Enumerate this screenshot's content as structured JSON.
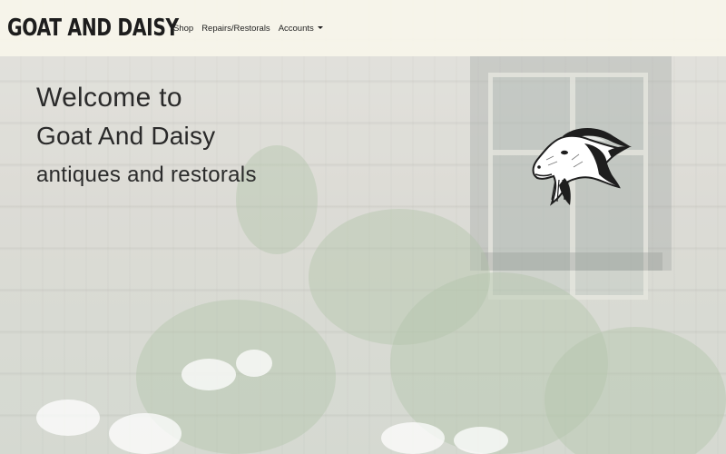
{
  "navbar": {
    "brand": "GOAT AND DAISY",
    "links": [
      {
        "label": "Shop"
      },
      {
        "label": "Repairs/Restorals"
      },
      {
        "label": "Accounts",
        "dropdown": true
      }
    ]
  },
  "hero": {
    "line1": "Welcome to",
    "line2": "Goat And Daisy",
    "line3": "antiques and restorals"
  },
  "icons": {
    "goat": "goat-head-icon",
    "caret": "caret-down-icon"
  },
  "colors": {
    "navbar_background": "#f7f5ea",
    "text": "#2a2a2a"
  }
}
